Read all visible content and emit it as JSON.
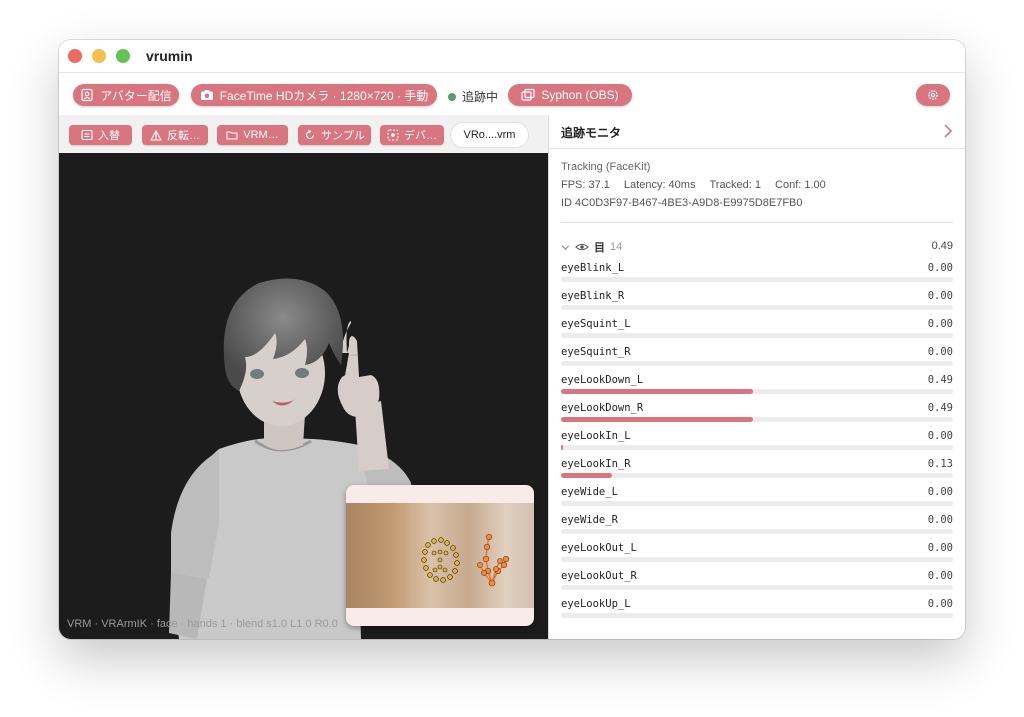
{
  "window": {
    "title": "vrumin"
  },
  "toolbar": {
    "avatar_stream_label": "アバター配信",
    "camera_label": "FaceTime HDカメラ · 1280×720 · 手動",
    "tracking_status": "追跡中",
    "syphon_label": "Syphon (OBS)"
  },
  "toolstrip": {
    "swap_label": "入替",
    "flip_label": "反転…",
    "vrm_label": "VRM…",
    "sample_label": "サンプル",
    "debug_label": "デバ…",
    "file_label": "VRo....vrm"
  },
  "viewport": {
    "overlay_text": "VRM · VRArmIK · face · hands 1 · blend s1.0 L1.0 R0.0"
  },
  "monitor": {
    "title": "追跡モニタ",
    "tracking_mode": "Tracking (FaceKit)",
    "fps": "FPS: 37.1",
    "latency": "Latency: 40ms",
    "tracked": "Tracked: 1",
    "conf": "Conf: 1.00",
    "id": "ID 4C0D3F97-B467-4BE3-A9D8-E9975D8E7FB0",
    "blendshape_group_label": "目",
    "blendshape_count": "14",
    "blendshape_peak": "0.49",
    "blendshapes": [
      {
        "name": "eyeBlink_L",
        "value": "0.00",
        "level": 0.0
      },
      {
        "name": "eyeBlink_R",
        "value": "0.00",
        "level": 0.0
      },
      {
        "name": "eyeSquint_L",
        "value": "0.00",
        "level": 0.0
      },
      {
        "name": "eyeSquint_R",
        "value": "0.00",
        "level": 0.0
      },
      {
        "name": "eyeLookDown_L",
        "value": "0.49",
        "level": 0.49
      },
      {
        "name": "eyeLookDown_R",
        "value": "0.49",
        "level": 0.49
      },
      {
        "name": "eyeLookIn_L",
        "value": "0.00",
        "level": 0.0
      },
      {
        "name": "eyeLookIn_R",
        "value": "0.13",
        "level": 0.13
      },
      {
        "name": "eyeWide_L",
        "value": "0.00",
        "level": 0.0
      },
      {
        "name": "eyeWide_R",
        "value": "0.00",
        "level": 0.0
      },
      {
        "name": "eyeLookOut_L",
        "value": "0.00",
        "level": 0.0
      },
      {
        "name": "eyeLookOut_R",
        "value": "0.00",
        "level": 0.0
      },
      {
        "name": "eyeLookUp_L",
        "value": "0.00",
        "level": 0.0
      }
    ]
  },
  "colors": {
    "accent": "#d9757f",
    "status_ok": "#5a9b6e"
  },
  "icons": {
    "avatar_stream": "person-badge-icon",
    "camera": "camera-icon",
    "syphon": "windows-stack-icon",
    "settings": "gear-icon",
    "swap": "swap-icon",
    "flip": "flip-icon",
    "vrm": "folder-icon",
    "sample": "refresh-icon",
    "debug": "target-icon",
    "monitor_expand": "chevron-right-icon",
    "group_collapse": "chevron-down-icon",
    "visibility": "eye-icon"
  }
}
